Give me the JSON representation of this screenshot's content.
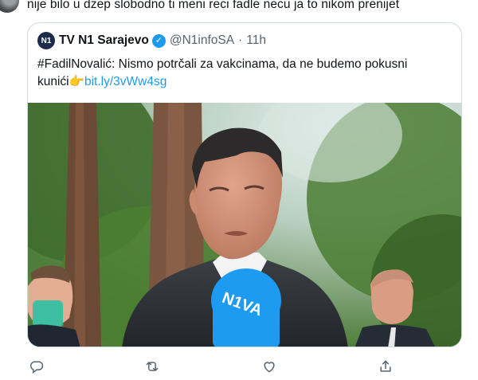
{
  "reply": {
    "text": "nije bilo u dzep slobodno ti meni reci fadle necu ja to nikom prenijet"
  },
  "quote": {
    "avatar_text": "N1",
    "name": "TV N1 Sarajevo",
    "verified_icon": "verified-badge-icon",
    "handle": "@N1infoSA",
    "dot": "·",
    "time": "11h",
    "text_line1": "#FadilNovalić: Nismo potrčali za vakcinama, da ne budemo pokusni",
    "text_line2_prefix": "kunići",
    "pointing_emoji": "👉",
    "link": "bit.ly/3vWw4sg",
    "media": {
      "microphone_label": "N1VA"
    }
  },
  "actions": [
    {
      "name": "reply-icon"
    },
    {
      "name": "retweet-icon"
    },
    {
      "name": "like-icon"
    },
    {
      "name": "share-icon"
    }
  ],
  "colors": {
    "accent": "#1d9bf0",
    "muted": "#536471",
    "border": "#cfd9de"
  }
}
